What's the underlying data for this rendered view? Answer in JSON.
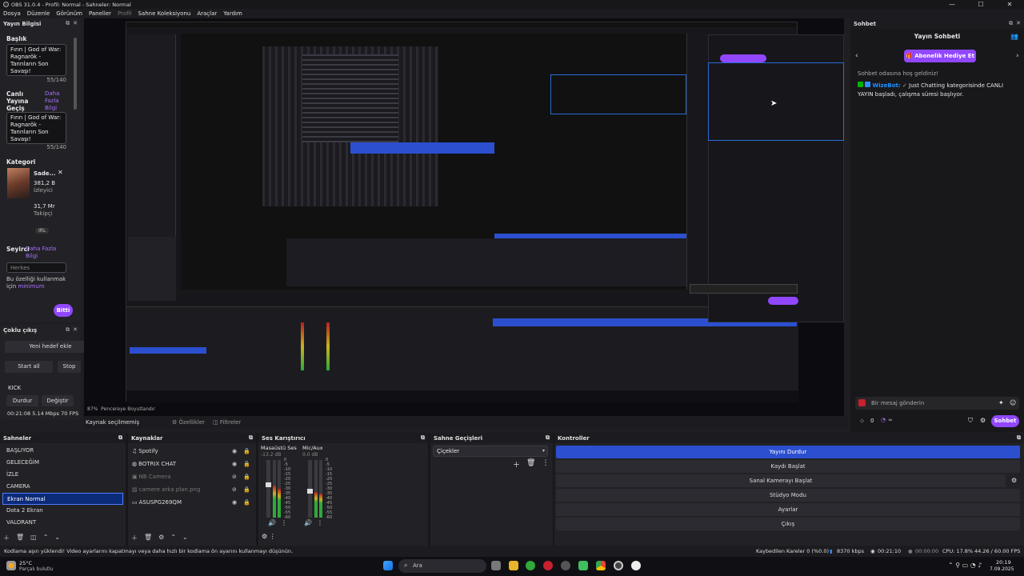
{
  "window": {
    "title": "OBS 31.0.4 - Profil: Normal - Sahneler: Normal",
    "controls": [
      "—",
      "☐",
      "✕"
    ]
  },
  "menu": [
    "Dosya",
    "Düzenle",
    "Görünüm",
    "Paneller",
    "Profil",
    "Sahne Koleksiyonu",
    "Araçlar",
    "Yardım"
  ],
  "stream_info": {
    "header": "Yayın Bilgisi",
    "title_label": "Başlık",
    "title_value": "Fırın | God of War: Ragnarök - Tanrıların Son Savaşı!",
    "title_count": "55/140",
    "go_live_label": "Canlı Yayına Geçiş Bildirimi",
    "more_info": "Daha Fazla Bilgi",
    "notify_value": "Fırın | God of War: Ragnarök - Tanrıların Son Savaşı!",
    "notify_count": "55/140",
    "category_label": "Kategori",
    "category_name": "Sade...",
    "category_viewers": "381,2 B",
    "category_viewers_label": "İzleyici",
    "category_followers": "31,7 Mr",
    "category_followers_label": "Takipçi",
    "category_tag": "IRL",
    "audience_label": "Seyirci",
    "audience_more": "Daha Fazla Bilgi",
    "audience_value": "Herkes",
    "audience_note": "Bu özelliği kullanmak için",
    "audience_note_link": "minimum",
    "done_button": "Bitti"
  },
  "multistream": {
    "header": "Çoklu çıkış",
    "new_target": "Yeni hedef ekle",
    "start_all": "Start all",
    "stop": "Stop",
    "platform": "KICK",
    "pause": "Durdur",
    "change": "Değiştir",
    "stats": "00:21:08  5.14 Mbps  70 FPS"
  },
  "preview_bar": {
    "zoom": "87%",
    "label": "Pencereye Boyutlandır"
  },
  "source_bar": {
    "none_selected": "Kaynak seçilmemiş",
    "properties": "Özellikler",
    "filters": "Filtreler"
  },
  "chat": {
    "header": "Sohbet",
    "title": "Yayın Sohbeti",
    "gift_button": "Abonelik Hediye Et",
    "welcome": "Sohbet odasına hoş geldiniz!",
    "bot_name": "WizeBot:",
    "bot_message": "Just Chatting kategorisinde CANLI YAYIN başladı, çalışma süresi başlıyor.",
    "input_placeholder": "Bir mesaj gönderin",
    "points": "0",
    "send_button": "Sohbet"
  },
  "scenes": {
    "header": "Sahneler",
    "items": [
      "BAŞLIYOR",
      "GELECEĞİM",
      "İZLE",
      "CAMERA",
      "Ekran Normal",
      "Dota 2 Ekran",
      "VALORANT"
    ],
    "selected": "Ekran Normal"
  },
  "sources": {
    "header": "Kaynaklar",
    "items": [
      {
        "name": "Spotify",
        "icon": "music-icon",
        "visible": true
      },
      {
        "name": "BOTRIX CHAT",
        "icon": "globe-icon",
        "visible": true
      },
      {
        "name": "NB Camera",
        "icon": "camera-icon",
        "visible": false
      },
      {
        "name": "camere arka plan.png",
        "icon": "image-icon",
        "visible": false
      },
      {
        "name": "ASUSPG269QM",
        "icon": "monitor-icon",
        "visible": true
      }
    ]
  },
  "mixer": {
    "header": "Ses Karıştırıcı",
    "channels": [
      {
        "name": "Masaüstü Ses",
        "db": "-13.2 dB",
        "level": 0.55
      },
      {
        "name": "Mic/Aux",
        "db": "0.0 dB",
        "level": 0.45
      }
    ],
    "ticks": [
      "0",
      "-5",
      "-10",
      "-15",
      "-20",
      "-25",
      "-30",
      "-35",
      "-40",
      "-45",
      "-50",
      "-55",
      "-60"
    ]
  },
  "transitions": {
    "header": "Sahne Geçişleri",
    "value": "Çiçekler"
  },
  "controls": {
    "header": "Kontroller",
    "buttons": [
      "Yayını Durdur",
      "Kaydı Başlat",
      "Sanal Kamerayı Başlat",
      "Stüdyo Modu",
      "Ayarlar",
      "Çıkış"
    ]
  },
  "status": {
    "message": "Kodlama aşırı yüklendi! Video ayarlarını kapatmayı veya daha hızlı bir kodlama ön ayarını kullanmayı düşünün.",
    "dropped": "Kaybedilen Kareler 0 (%0.0)",
    "bitrate": "8370 kbps",
    "stream_time": "00:21:10",
    "rec_time": "00:00:00",
    "cpu": "CPU: 17.8%",
    "fps": "44.26 / 60.00 FPS"
  },
  "taskbar": {
    "weather_temp": "25°C",
    "weather_desc": "Parçalı bulutlu",
    "search": "Ara",
    "time": "20:19",
    "date": "7.09.2025"
  }
}
